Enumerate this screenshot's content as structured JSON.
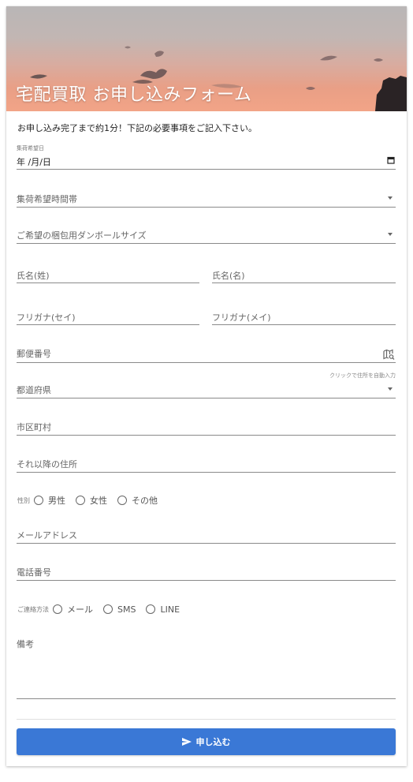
{
  "header": {
    "title": "宅配買取 お申し込みフォーム"
  },
  "intro": "お申し込み完了まで約1分！下記の必要事項をご記入下さい。",
  "fields": {
    "pickup_date": {
      "label": "集荷希望日",
      "value": "年 /月/日"
    },
    "pickup_time": {
      "placeholder": "集荷希望時間帯"
    },
    "box_size": {
      "placeholder": "ご希望の梱包用ダンボールサイズ"
    },
    "last_name": {
      "placeholder": "氏名(姓)"
    },
    "first_name": {
      "placeholder": "氏名(名)"
    },
    "last_kana": {
      "placeholder": "フリガナ(セイ)"
    },
    "first_kana": {
      "placeholder": "フリガナ(メイ)"
    },
    "postal": {
      "placeholder": "郵便番号",
      "hint": "クリックで住所を自動入力"
    },
    "prefecture": {
      "placeholder": "都道府県"
    },
    "city": {
      "placeholder": "市区町村"
    },
    "address": {
      "placeholder": "それ以降の住所"
    },
    "email": {
      "placeholder": "メールアドレス"
    },
    "phone": {
      "placeholder": "電話番号"
    },
    "notes": {
      "placeholder": "備考"
    }
  },
  "gender": {
    "label": "性別",
    "options": [
      "男性",
      "女性",
      "その他"
    ]
  },
  "contact": {
    "label": "ご連絡方法",
    "options": [
      "メール",
      "SMS",
      "LINE"
    ]
  },
  "submit": {
    "label": "申し込む"
  },
  "colors": {
    "accent": "#3a78d6"
  }
}
